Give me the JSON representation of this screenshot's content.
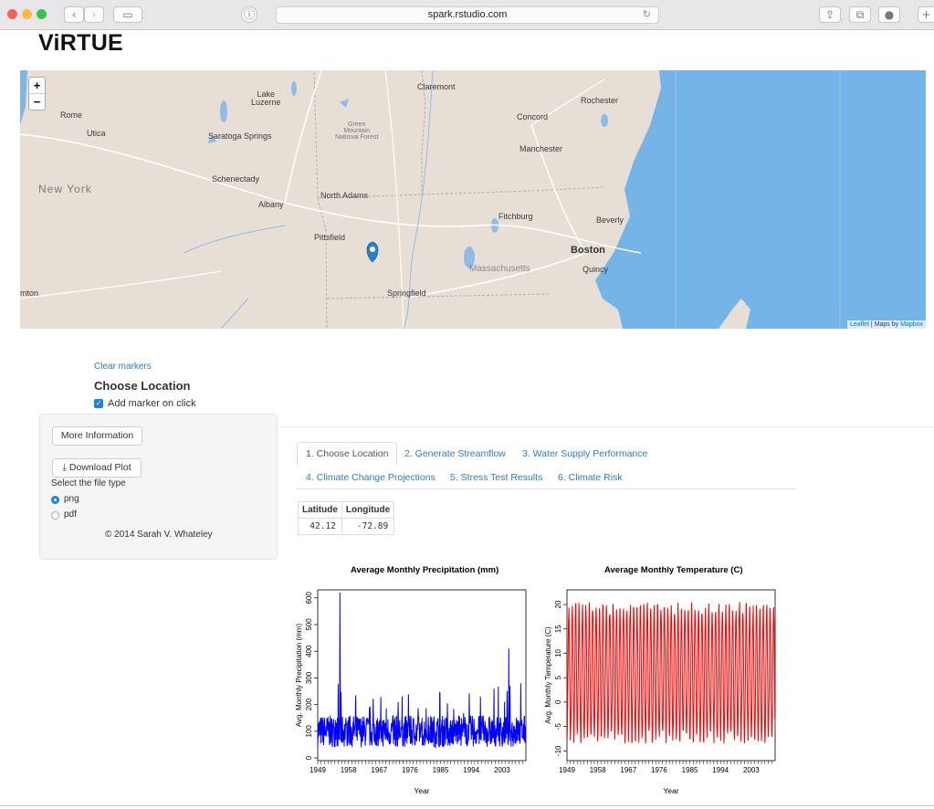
{
  "browser": {
    "url": "spark.rstudio.com",
    "traffic_colors": [
      "#fc605c",
      "#fdbc40",
      "#34c84a"
    ]
  },
  "brand": "ViRTUE",
  "map": {
    "zoom_in": "+",
    "zoom_out": "−",
    "labels": {
      "lake_luzerne": "Lake\nLuzerne",
      "claremont": "Claremont",
      "rochester": "Rochester",
      "rome": "Rome",
      "utica": "Utica",
      "saratoga": "Saratoga Springs",
      "green_mountain": "Green\nMountain\nNational Forest",
      "concord": "Concord",
      "manchester": "Manchester",
      "schenectady": "Schenectady",
      "new_york": "New York",
      "albany": "Albany",
      "north_adams": "North Adams",
      "fitchburg": "Fitchburg",
      "beverly": "Beverly",
      "pittsfield": "Pittsfield",
      "boston": "Boston",
      "massachusetts": "Massachusetts",
      "quincy": "Quincy",
      "springfield": "Springfield",
      "mton": "mton"
    },
    "attribution_leaflet": "Leaflet",
    "attribution_sep": " | Maps by ",
    "attribution_mapbox": "Mapbox"
  },
  "controls": {
    "clear_markers": "Clear markers",
    "choose_location": "Choose Location",
    "add_marker": "Add marker on click",
    "more_info": "More Information",
    "download_plot": "Download Plot",
    "file_type_label": "Select the file type",
    "png": "png",
    "pdf": "pdf",
    "copyright": "© 2014 Sarah V. Whateley"
  },
  "tabs": [
    {
      "label": "1. Choose Location",
      "active": true
    },
    {
      "label": "2. Generate Streamflow"
    },
    {
      "label": "3. Water Supply Performance"
    },
    {
      "label": "4. Climate Change Projections"
    },
    {
      "label": "5. Stress Test Results"
    },
    {
      "label": "6. Climate Risk"
    }
  ],
  "location_table": {
    "headers": [
      "Latitude",
      "Longitude"
    ],
    "values": [
      "42.12",
      "-72.89"
    ]
  },
  "chart_data": [
    {
      "type": "line",
      "title": "Average Monthly Precipitation (mm)",
      "xlabel": "Year",
      "ylabel": "Avg. Monthly Precipitation (mm)",
      "xlim": [
        1949,
        2010
      ],
      "ylim": [
        -10,
        630
      ],
      "yticks": [
        0,
        100,
        200,
        300,
        400,
        500,
        600
      ],
      "xticks": [
        "1949",
        "1958",
        "1967",
        "1976",
        "1985",
        "1994",
        "2003"
      ],
      "color": "#0000ff",
      "series": [
        {
          "x": [
            1949,
            1951,
            1953,
            1955,
            1955.5,
            1957,
            1960,
            1963,
            1966,
            1969,
            1972,
            1975,
            1978,
            1981,
            1984,
            1987,
            1990,
            1993,
            1996,
            1999,
            2002,
            2005,
            2006,
            2008,
            2010
          ],
          "y": [
            95,
            120,
            100,
            150,
            620,
            110,
            90,
            85,
            80,
            100,
            115,
            130,
            150,
            200,
            160,
            140,
            120,
            150,
            130,
            140,
            160,
            410,
            170,
            150,
            130
          ]
        }
      ]
    },
    {
      "type": "line",
      "title": "Average Monthly Temperature (C)",
      "xlabel": "Year",
      "ylabel": "Avg. Monthly Temperature (C)",
      "xlim": [
        1949,
        2010
      ],
      "ylim": [
        -12,
        23
      ],
      "yticks": [
        -10,
        -5,
        0,
        5,
        10,
        15,
        20
      ],
      "xticks": [
        "1949",
        "1958",
        "1967",
        "1976",
        "1985",
        "1994",
        "2003"
      ],
      "color": "#ff0000",
      "series": [
        {
          "x": [
            1949,
            2010
          ],
          "y_max": [
            21,
            22
          ],
          "y_min": [
            -8,
            -8
          ]
        }
      ]
    }
  ]
}
